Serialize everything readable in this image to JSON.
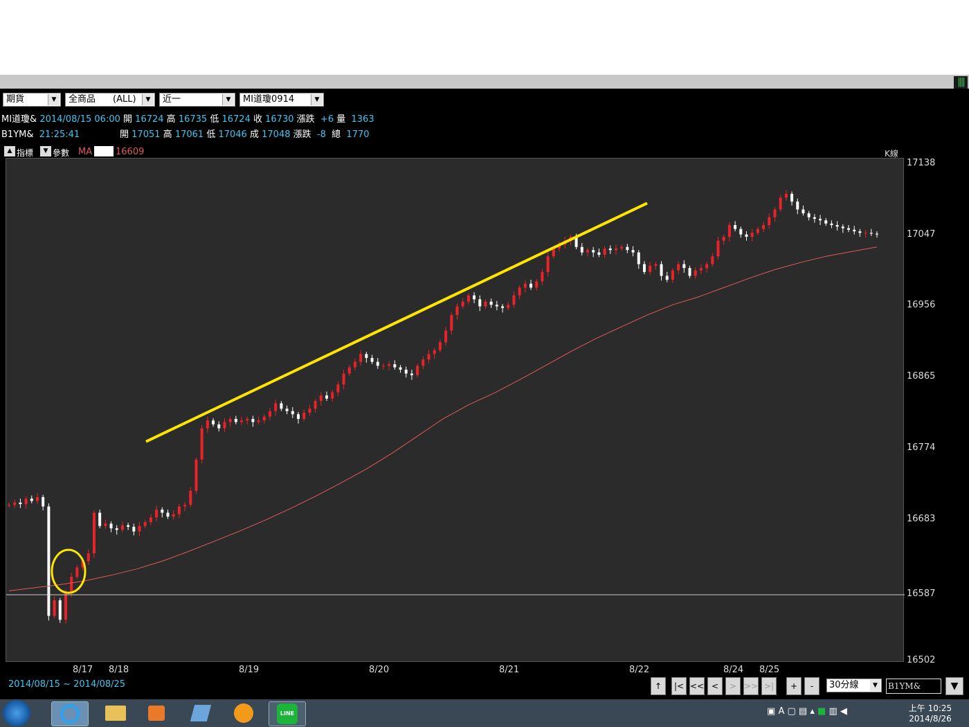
{
  "controls": {
    "market": "期貨",
    "products": "全商品",
    "products_all": "(ALL)",
    "period": "近一",
    "symbol": "MI道瓊0914"
  },
  "quote1": {
    "name": "MI道瓊&",
    "date": "2014/08/15 06:00",
    "open_label": "開",
    "open": "16724",
    "high_label": "高",
    "high": "16735",
    "low_label": "低",
    "low": "16724",
    "close_label": "收",
    "close": "16730",
    "chg_label": "漲跌",
    "chg": "+6",
    "vol_label": "量",
    "vol": "1363"
  },
  "quote2": {
    "name": "B1YM&",
    "time": "21:25:41",
    "open_label": "開",
    "open": "17051",
    "high_label": "高",
    "high": "17061",
    "low_label": "低",
    "low": "17046",
    "last_label": "成",
    "last": "17048",
    "chg_label": "漲跌",
    "chg": "-8",
    "total_label": "總",
    "total": "1770"
  },
  "indicator_bar": {
    "index_label": "指標",
    "param_label": "參數",
    "ma_label": "MA",
    "ma_value": "16609",
    "chart_type": "K線"
  },
  "range": {
    "start": "2014/08/15",
    "sep": "~",
    "end": "2014/08/25"
  },
  "nav_buttons": [
    "↑",
    "|<",
    "<<",
    "<",
    ">",
    ">>",
    ">|",
    "+",
    "-"
  ],
  "interval_select": "30分線",
  "symbol_input": "B1YM&",
  "taskbar": {
    "time": "上午 10:25",
    "date": "2014/8/26",
    "line_label": "LINE"
  },
  "colors": {
    "up": "#e8232a",
    "down": "#ffffff",
    "ma": "#e05a5a",
    "trendline": "#ffe600",
    "price": "#ffffff",
    "background": "#2b2b2b"
  },
  "chart_data": {
    "type": "candlestick",
    "ylim": [
      16502,
      17138
    ],
    "yticks": [
      17138,
      17047,
      16956,
      16865,
      16774,
      16683,
      16502
    ],
    "current_price_line": 16587,
    "xlabels": [
      "8/17",
      "8/18",
      "8/19",
      "8/20",
      "8/21",
      "8/22",
      "8/24",
      "8/25"
    ],
    "ma_label": "MA 16609",
    "close_path": [
      16702,
      16705,
      16703,
      16710,
      16707,
      16712,
      16700,
      16560,
      16580,
      16555,
      16590,
      16610,
      16622,
      16630,
      16640,
      16692,
      16675,
      16678,
      16672,
      16670,
      16676,
      16674,
      16668,
      16675,
      16680,
      16686,
      16696,
      16692,
      16687,
      16690,
      16700,
      16702,
      16720,
      16760,
      16800,
      16810,
      16805,
      16800,
      16808,
      16812,
      16808,
      16810,
      16812,
      16808,
      16810,
      16815,
      16822,
      16832,
      16825,
      16822,
      16818,
      16812,
      16820,
      16825,
      16835,
      16842,
      16838,
      16846,
      16856,
      16870,
      16878,
      16885,
      16895,
      16890,
      16885,
      16880,
      16880,
      16882,
      16878,
      16875,
      16870,
      16868,
      16880,
      16888,
      16895,
      16900,
      16910,
      16925,
      16945,
      16956,
      16962,
      16970,
      16965,
      16956,
      16962,
      16958,
      16956,
      16954,
      16958,
      16970,
      16980,
      16985,
      16980,
      16988,
      17000,
      17020,
      17030,
      17035,
      17040,
      17045,
      17032,
      17025,
      17028,
      17025,
      17022,
      17030,
      17028,
      17030,
      17032,
      17028,
      17025,
      17010,
      17000,
      17008,
      17010,
      16995,
      16990,
      17002,
      17010,
      17005,
      16995,
      17002,
      17005,
      17010,
      17020,
      17040,
      17045,
      17060,
      17055,
      17048,
      17045,
      17050,
      17055,
      17060,
      17070,
      17080,
      17095,
      17100,
      17090,
      17080,
      17075,
      17070,
      17068,
      17066,
      17062,
      17060,
      17058,
      17056,
      17054,
      17052,
      17050,
      17050,
      17049,
      17048
    ],
    "ma_path": [
      16592,
      16596,
      16600,
      16605,
      16612,
      16620,
      16630,
      16642,
      16655,
      16668,
      16682,
      16697,
      16713,
      16730,
      16748,
      16768,
      16790,
      16812,
      16830,
      16845,
      16862,
      16880,
      16898,
      16915,
      16930,
      16945,
      16958,
      16968,
      16980,
      16992,
      17003,
      17012,
      17020,
      17026,
      17032
    ]
  }
}
